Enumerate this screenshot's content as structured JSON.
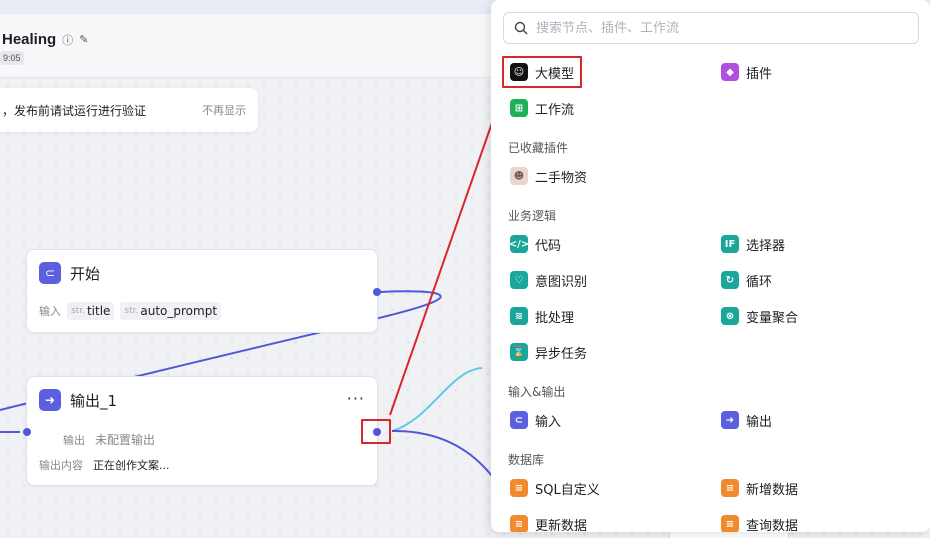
{
  "header": {
    "title": "Healing",
    "time": "9:05"
  },
  "notice": {
    "message": "，发布前请试运行进行验证",
    "dismiss": "不再显示"
  },
  "nodes": {
    "start": {
      "title": "开始",
      "input_label": "输入",
      "params": [
        {
          "type": "str.",
          "name": "title"
        },
        {
          "type": "str.",
          "name": "auto_prompt"
        }
      ]
    },
    "output": {
      "title": "输出_1",
      "more": "···",
      "output_label": "输出",
      "output_value": "未配置输出",
      "content_label": "输出内容",
      "content_value": "正在创作文案..."
    }
  },
  "panel": {
    "search_placeholder": "搜索节点、插件、工作流",
    "top_items": [
      {
        "label": "大模型",
        "icon": "llm-icon",
        "color": "#111111"
      },
      {
        "label": "插件",
        "icon": "plugin-icon",
        "color": "#b14fe0"
      },
      {
        "label": "工作流",
        "icon": "workflow-icon",
        "color": "#21b05a"
      }
    ],
    "sections": [
      {
        "title": "已收藏插件",
        "items": [
          {
            "label": "二手物资",
            "icon": "avatar-icon",
            "color": "#e9d6d0"
          }
        ]
      },
      {
        "title": "业务逻辑",
        "items": [
          {
            "label": "代码",
            "icon": "code-icon",
            "color": "#1aa79b"
          },
          {
            "label": "选择器",
            "icon": "condition-icon",
            "color": "#1aa79b"
          },
          {
            "label": "意图识别",
            "icon": "intent-icon",
            "color": "#1aa79b"
          },
          {
            "label": "循环",
            "icon": "loop-icon",
            "color": "#1aa79b"
          },
          {
            "label": "批处理",
            "icon": "batch-icon",
            "color": "#1aa79b"
          },
          {
            "label": "变量聚合",
            "icon": "aggregate-icon",
            "color": "#1aa79b"
          },
          {
            "label": "异步任务",
            "icon": "async-task-icon",
            "color": "#1aa79b"
          }
        ]
      },
      {
        "title": "输入&输出",
        "items": [
          {
            "label": "输入",
            "icon": "input-icon",
            "color": "#5b5fe0"
          },
          {
            "label": "输出",
            "icon": "output-icon",
            "color": "#5b5fe0"
          }
        ]
      },
      {
        "title": "数据库",
        "items": [
          {
            "label": "SQL自定义",
            "icon": "sql-icon",
            "color": "#f08a2c"
          },
          {
            "label": "新增数据",
            "icon": "add-data-icon",
            "color": "#f08a2c"
          },
          {
            "label": "更新数据",
            "icon": "update-data-icon",
            "color": "#f08a2c"
          },
          {
            "label": "查询数据",
            "icon": "query-data-icon",
            "color": "#f08a2c"
          }
        ]
      }
    ]
  },
  "colors": {
    "accent": "#5058d8",
    "highlight": "#d8262b",
    "teal": "#1aa79b",
    "cyan_edge": "#5ecbe0"
  }
}
